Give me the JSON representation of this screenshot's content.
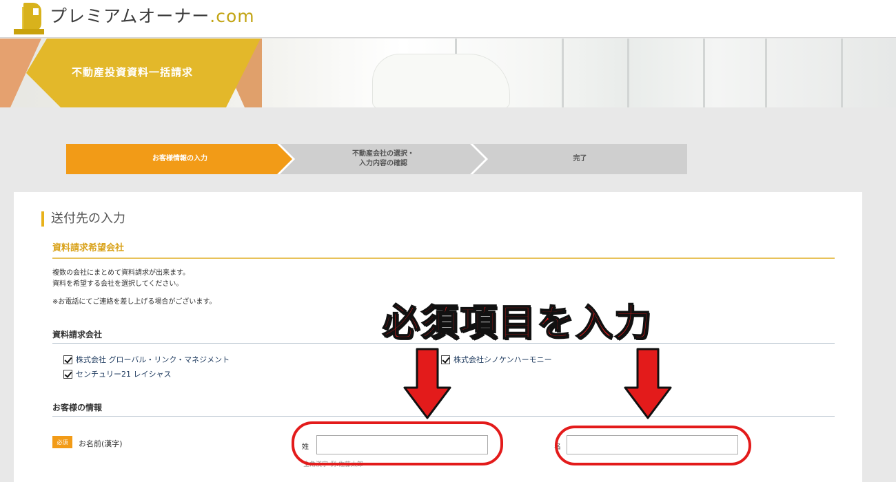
{
  "header": {
    "logo_text": "プレミアムオーナー",
    "logo_domain": ".com"
  },
  "hero": {
    "title": "不動産投資資料一括請求"
  },
  "steps": [
    {
      "label": "お客様情報の入力",
      "state": "active"
    },
    {
      "label_line1": "不動産会社の選択・",
      "label_line2": "入力内容の確認",
      "state": "inactive"
    },
    {
      "label": "完了",
      "state": "inactive"
    }
  ],
  "form": {
    "section_title": "送付先の入力",
    "request_heading": "資料請求希望会社",
    "desc_line1": "複数の会社にまとめて資料請求が出来ます。",
    "desc_line2": "資料を希望する会社を選択してください。",
    "note": "※お電話にてご連絡を差し上げる場合がございます。",
    "companies_heading": "資料請求会社",
    "companies": [
      {
        "name": "株式会社 グローバル・リンク・マネジメント",
        "checked": true
      },
      {
        "name": "株式会社シノケンハーモニー",
        "checked": true
      },
      {
        "name": "センチュリー21 レイシャス",
        "checked": true
      }
    ],
    "customer_heading": "お客様の情報",
    "required_badge": "必須",
    "name_label": "お名前(漢字)",
    "last_name_label": "姓",
    "first_name_label": "名",
    "last_name_value": "",
    "first_name_value": "",
    "hint": "全角漢字 例:佐藤太郎"
  },
  "annotation": {
    "text": "必須項目を入力",
    "color": "#e51a1a"
  },
  "colors": {
    "accent_orange": "#f29b17",
    "gold": "#e3b82a",
    "annotation_red": "#e31b1b"
  }
}
